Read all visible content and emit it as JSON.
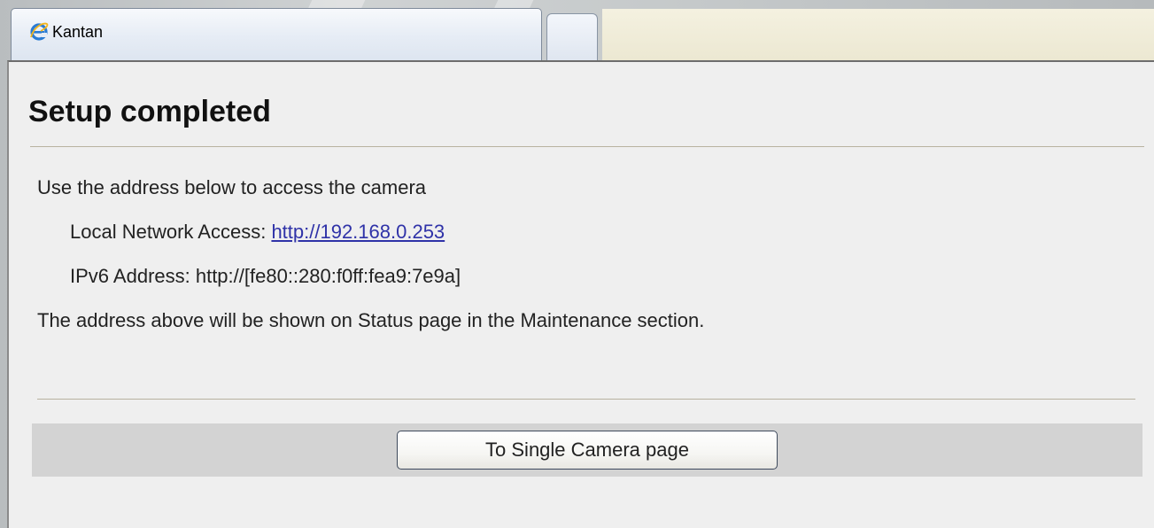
{
  "tab": {
    "title": "Kantan",
    "icon": "internet-explorer-icon"
  },
  "page": {
    "title": "Setup completed",
    "intro": "Use the address below to access the camera",
    "local_access_label": "Local Network Access: ",
    "local_access_url": "http://192.168.0.253",
    "ipv6_line": "IPv6 Address: http://[fe80::280:f0ff:fea9:7e9a]",
    "note": "The address above will be shown on Status page in the Maintenance section.",
    "button_label": "To Single Camera page"
  },
  "colors": {
    "link": "#2f32a8",
    "page_background": "#efefef",
    "button_bar": "#d3d3d3"
  }
}
